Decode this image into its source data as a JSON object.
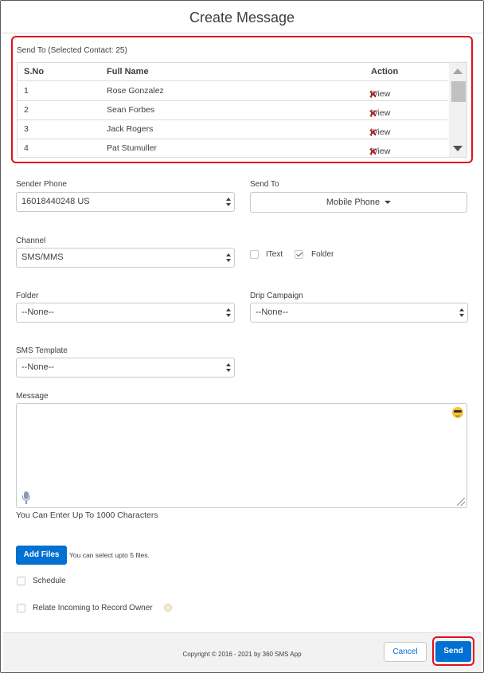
{
  "header": {
    "title": "Create Message"
  },
  "recipients": {
    "title": "Send To (Selected Contact: 25)",
    "columns": {
      "sno": "S.No",
      "name": "Full Name",
      "action": "Action"
    },
    "rows": [
      {
        "sno": "1",
        "name": "Rose Gonzalez",
        "action": "|View"
      },
      {
        "sno": "2",
        "name": "Sean Forbes",
        "action": "|View"
      },
      {
        "sno": "3",
        "name": "Jack Rogers",
        "action": "|View"
      },
      {
        "sno": "4",
        "name": "Pat Stumuller",
        "action": "|View"
      }
    ]
  },
  "form": {
    "sender_phone": {
      "label": "Sender Phone",
      "value": "16018440248 US"
    },
    "send_to": {
      "label": "Send To",
      "value": "Mobile Phone"
    },
    "channel": {
      "label": "Channel",
      "value": "SMS/MMS"
    },
    "itext": {
      "label": "IText",
      "checked": false
    },
    "folder_check": {
      "label": "Folder",
      "checked": true
    },
    "folder": {
      "label": "Folder",
      "value": "--None--"
    },
    "drip_campaign": {
      "label": "Drip Campaign",
      "value": "--None--"
    },
    "sms_template": {
      "label": "SMS Template",
      "value": "--None--"
    },
    "message": {
      "label": "Message",
      "value": "",
      "hint": "You Can Enter Up To 1000 Characters"
    },
    "add_files": {
      "label": "Add Files",
      "hint": "You can select upto 5 files."
    },
    "schedule": {
      "label": "Schedule",
      "checked": false
    },
    "relate_incoming": {
      "label": "Relate Incoming to Record Owner",
      "checked": false
    }
  },
  "footer": {
    "copyright": "Copyright © 2016 - 2021 by 360 SMS App",
    "cancel_label": "Cancel",
    "send_label": "Send"
  },
  "colors": {
    "accent": "#0070d2",
    "highlight": "#e0101a"
  },
  "icons": [
    "delete-x-icon",
    "smiley-emoji-icon",
    "microphone-icon",
    "help-icon",
    "select-arrows-icon",
    "caret-down-icon"
  ]
}
